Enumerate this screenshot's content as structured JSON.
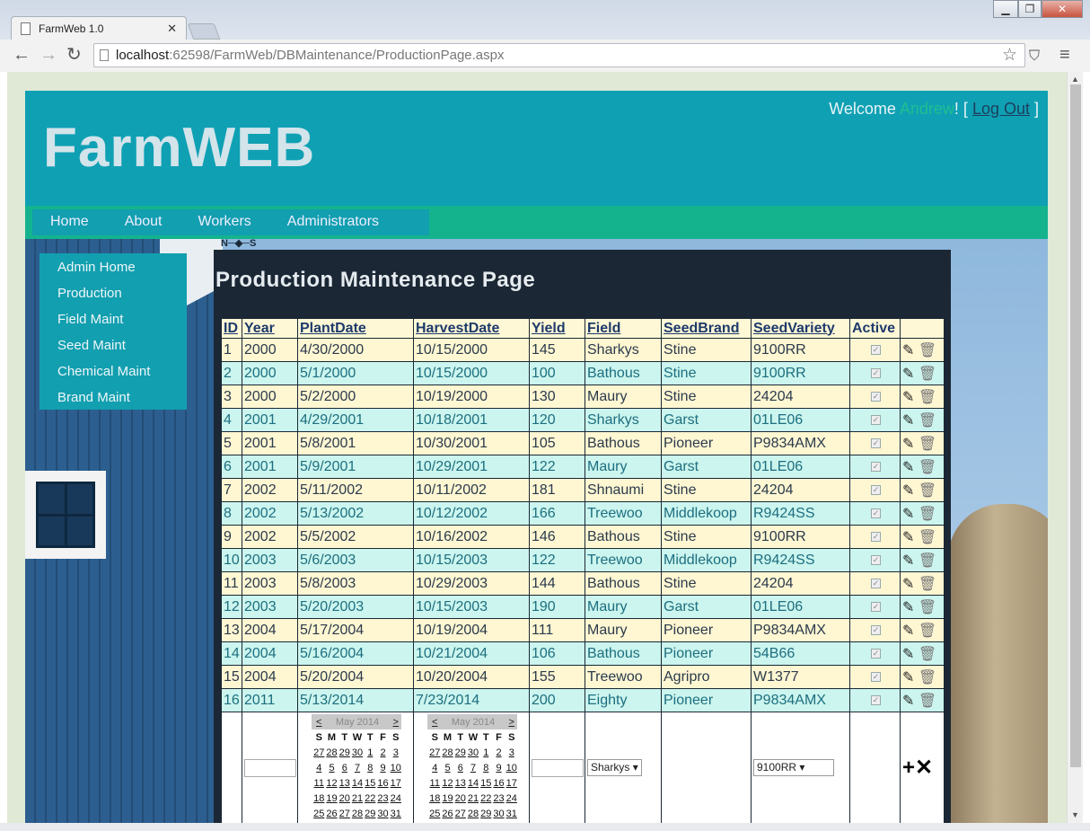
{
  "browser": {
    "tab_title": "FarmWeb 1.0",
    "url_host": "localhost",
    "url_path": ":62598/FarmWeb/DBMaintenance/ProductionPage.aspx"
  },
  "site": {
    "logo": "FarmWEB",
    "welcome_prefix": "Welcome ",
    "user": "Andrew",
    "welcome_mid": "! [ ",
    "logout": "Log Out",
    "welcome_suffix": " ]",
    "menu": [
      "Home",
      "About",
      "Workers",
      "Administrators"
    ],
    "compass": "N─◆─S",
    "sidemenu": [
      "Admin Home",
      "Production",
      "Field Maint",
      "Seed Maint",
      "Chemical Maint",
      "Brand Maint"
    ]
  },
  "page_title": "Production Maintenance Page",
  "grid": {
    "headers": [
      "ID",
      "Year",
      "PlantDate",
      "HarvestDate",
      "Yield",
      "Field",
      "SeedBrand",
      "SeedVariety",
      "Active"
    ],
    "rows": [
      [
        "1",
        "2000",
        "4/30/2000",
        "10/15/2000",
        "145",
        "Sharkys",
        "Stine",
        "9100RR"
      ],
      [
        "2",
        "2000",
        "5/1/2000",
        "10/15/2000",
        "100",
        "Bathous",
        "Stine",
        "9100RR"
      ],
      [
        "3",
        "2000",
        "5/2/2000",
        "10/19/2000",
        "130",
        "Maury",
        "Stine",
        "24204"
      ],
      [
        "4",
        "2001",
        "4/29/2001",
        "10/18/2001",
        "120",
        "Sharkys",
        "Garst",
        "01LE06"
      ],
      [
        "5",
        "2001",
        "5/8/2001",
        "10/30/2001",
        "105",
        "Bathous",
        "Pioneer",
        "P9834AMX"
      ],
      [
        "6",
        "2001",
        "5/9/2001",
        "10/29/2001",
        "122",
        "Maury",
        "Garst",
        "01LE06"
      ],
      [
        "7",
        "2002",
        "5/11/2002",
        "10/11/2002",
        "181",
        "Shnaumi",
        "Stine",
        "24204"
      ],
      [
        "8",
        "2002",
        "5/13/2002",
        "10/12/2002",
        "166",
        "Treewoo",
        "Middlekoop",
        "R9424SS"
      ],
      [
        "9",
        "2002",
        "5/5/2002",
        "10/16/2002",
        "146",
        "Bathous",
        "Stine",
        "9100RR"
      ],
      [
        "10",
        "2003",
        "5/6/2003",
        "10/15/2003",
        "122",
        "Treewoo",
        "Middlekoop",
        "R9424SS"
      ],
      [
        "11",
        "2003",
        "5/8/2003",
        "10/29/2003",
        "144",
        "Bathous",
        "Stine",
        "24204"
      ],
      [
        "12",
        "2003",
        "5/20/2003",
        "10/15/2003",
        "190",
        "Maury",
        "Garst",
        "01LE06"
      ],
      [
        "13",
        "2004",
        "5/17/2004",
        "10/19/2004",
        "111",
        "Maury",
        "Pioneer",
        "P9834AMX"
      ],
      [
        "14",
        "2004",
        "5/16/2004",
        "10/21/2004",
        "106",
        "Bathous",
        "Pioneer",
        "54B66"
      ],
      [
        "15",
        "2004",
        "5/20/2004",
        "10/20/2004",
        "155",
        "Treewoo",
        "Agripro",
        "W1377"
      ],
      [
        "16",
        "2011",
        "5/13/2014",
        "7/23/2014",
        "200",
        "Eighty",
        "Pioneer",
        "P9834AMX"
      ]
    ]
  },
  "calendar": {
    "prev": "<",
    "next": ">",
    "month": "May 2014",
    "days": [
      "S",
      "M",
      "T",
      "W",
      "T",
      "F",
      "S"
    ],
    "weeks": [
      [
        "27",
        "28",
        "29",
        "30",
        "1",
        "2",
        "3"
      ],
      [
        "4",
        "5",
        "6",
        "7",
        "8",
        "9",
        "10"
      ],
      [
        "11",
        "12",
        "13",
        "14",
        "15",
        "16",
        "17"
      ],
      [
        "18",
        "19",
        "20",
        "21",
        "22",
        "23",
        "24"
      ],
      [
        "25",
        "26",
        "27",
        "28",
        "29",
        "30",
        "31"
      ]
    ]
  },
  "insert": {
    "field_select": "Sharkys",
    "variety_select": "9100RR"
  },
  "icons": {
    "edit": "pencil-icon",
    "delete": "trash-icon",
    "add": "plus-icon",
    "cancel": "x-icon"
  }
}
